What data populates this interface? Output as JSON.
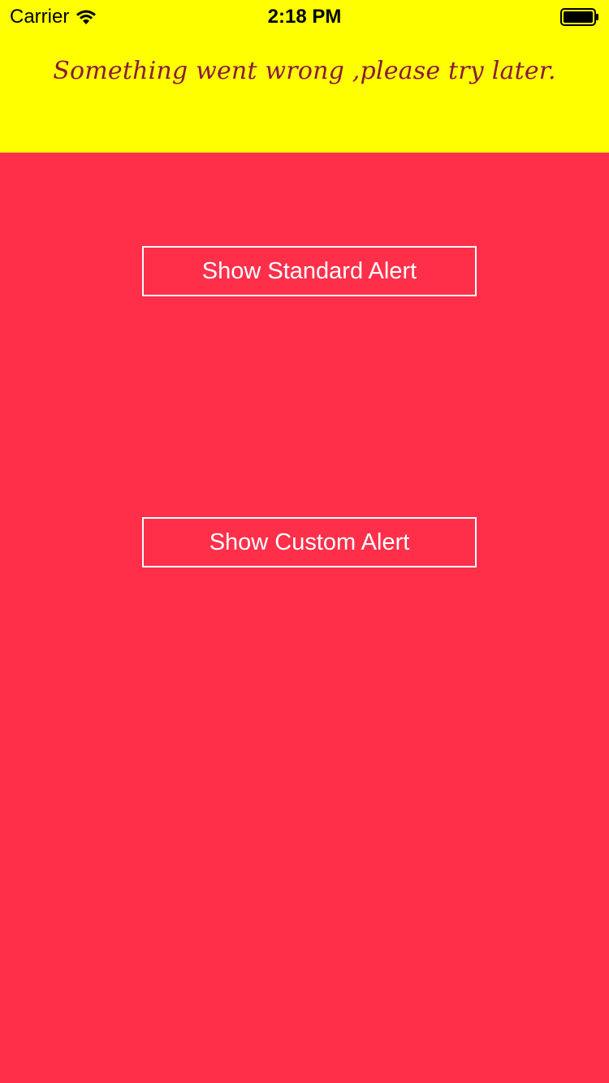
{
  "status_bar": {
    "carrier": "Carrier",
    "time": "2:18 PM",
    "wifi_icon": "wifi-icon",
    "battery_icon": "battery-icon"
  },
  "banner": {
    "message": "Something went wrong ,please try later.",
    "background": "#FFFF00",
    "text_color": "#8B1A3A"
  },
  "main": {
    "background": "#FF2F4A",
    "standard_alert_label": "Show Standard Alert",
    "custom_alert_label": "Show Custom Alert"
  }
}
